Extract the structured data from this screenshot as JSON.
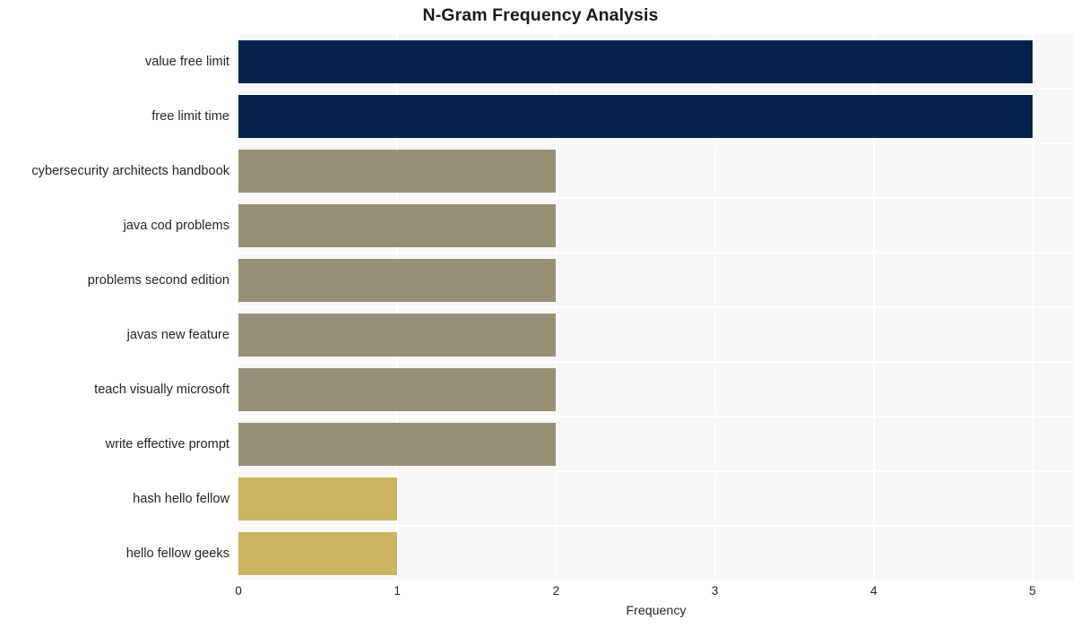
{
  "chart_data": {
    "type": "bar",
    "orientation": "horizontal",
    "title": "N-Gram Frequency Analysis",
    "xlabel": "Frequency",
    "ylabel": "",
    "xlim": [
      0,
      5.26
    ],
    "xticks": [
      0,
      1,
      2,
      3,
      4,
      5
    ],
    "xtick_labels": [
      "0",
      "1",
      "2",
      "3",
      "4",
      "5"
    ],
    "grid": true,
    "grid_color": "#ffffff",
    "plot_background": "#f7f7f7",
    "figure_background": "#ffffff",
    "legend": null,
    "categories": [
      "value free limit",
      "free limit time",
      "cybersecurity architects handbook",
      "java cod problems",
      "problems second edition",
      "javas new feature",
      "teach visually microsoft",
      "write effective prompt",
      "hash hello fellow",
      "hello fellow geeks"
    ],
    "values": [
      5,
      5,
      2,
      2,
      2,
      2,
      2,
      2,
      1,
      1
    ],
    "bar_colors": [
      "#04224c",
      "#04224c",
      "#979078",
      "#979078",
      "#979078",
      "#979078",
      "#979078",
      "#979078",
      "#c9b462",
      "#c9b462"
    ]
  }
}
